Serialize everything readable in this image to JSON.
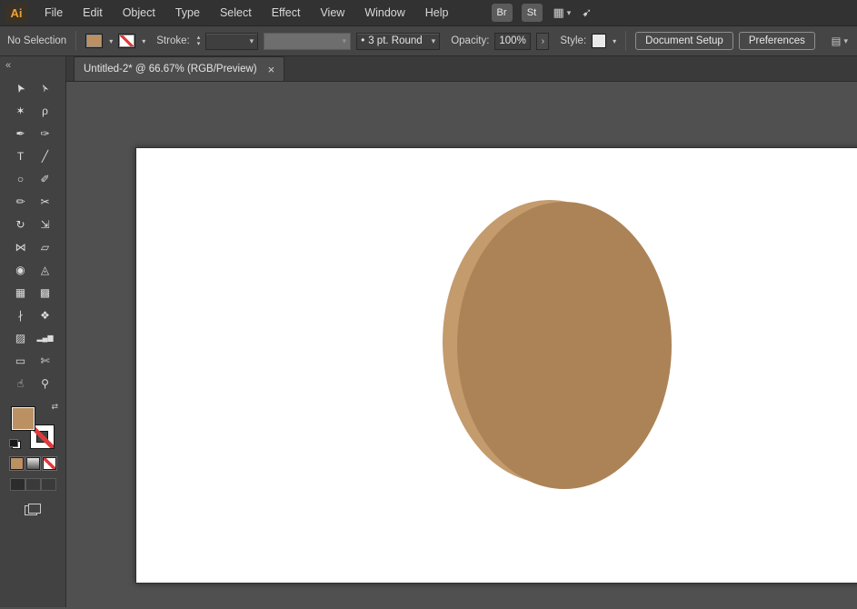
{
  "app": {
    "logo": "Ai"
  },
  "menu": {
    "items": [
      "File",
      "Edit",
      "Object",
      "Type",
      "Select",
      "Effect",
      "View",
      "Window",
      "Help"
    ]
  },
  "topbar": {
    "bridge": "Br",
    "stock": "St"
  },
  "control": {
    "status": "No Selection",
    "stroke_label": "Stroke:",
    "brush_tip": "•",
    "brush_name": "3 pt. Round",
    "opacity_label": "Opacity:",
    "opacity_value": "100%",
    "style_label": "Style:",
    "document_setup": "Document Setup",
    "preferences": "Preferences"
  },
  "tab": {
    "title": "Untitled-2* @ 66.67% (RGB/Preview)",
    "close": "×"
  },
  "icons": {
    "chevron_down": "▾",
    "chevron_right": "›",
    "spinner_up": "▴",
    "spinner_down": "▾",
    "collapse_left": "«",
    "swap": "⇄",
    "arrange_grid": "▦",
    "gpu": "➹",
    "panel": "▤"
  },
  "tools": [
    {
      "name": "selection-tool",
      "glyph": "➤"
    },
    {
      "name": "direct-selection-tool",
      "glyph": "➢"
    },
    {
      "name": "magic-wand-tool",
      "glyph": "✶"
    },
    {
      "name": "lasso-tool",
      "glyph": "ρ"
    },
    {
      "name": "pen-tool",
      "glyph": "✒"
    },
    {
      "name": "curvature-tool",
      "glyph": "✑"
    },
    {
      "name": "type-tool",
      "glyph": "T"
    },
    {
      "name": "line-segment-tool",
      "glyph": "╱"
    },
    {
      "name": "ellipse-tool",
      "glyph": "○"
    },
    {
      "name": "paintbrush-tool",
      "glyph": "✐"
    },
    {
      "name": "pencil-tool",
      "glyph": "✏"
    },
    {
      "name": "scissors-tool",
      "glyph": "✂"
    },
    {
      "name": "rotate-tool",
      "glyph": "↻"
    },
    {
      "name": "scale-tool",
      "glyph": "⇲"
    },
    {
      "name": "width-tool",
      "glyph": "⋈"
    },
    {
      "name": "free-transform-tool",
      "glyph": "▱"
    },
    {
      "name": "shape-builder-tool",
      "glyph": "◉"
    },
    {
      "name": "perspective-grid-tool",
      "glyph": "◬"
    },
    {
      "name": "mesh-tool",
      "glyph": "▦"
    },
    {
      "name": "gradient-tool",
      "glyph": "▩"
    },
    {
      "name": "eyedropper-tool",
      "glyph": "∤"
    },
    {
      "name": "blend-tool",
      "glyph": "❖"
    },
    {
      "name": "symbol-sprayer-tool",
      "glyph": "▨"
    },
    {
      "name": "column-graph-tool",
      "glyph": "▂▄▆"
    },
    {
      "name": "artboard-tool",
      "glyph": "▭"
    },
    {
      "name": "slice-tool",
      "glyph": "✄"
    },
    {
      "name": "hand-tool",
      "glyph": "☝"
    },
    {
      "name": "zoom-tool",
      "glyph": "⚲"
    }
  ],
  "colors": {
    "fill_brown": "#BB9164",
    "ellipse_front": "#AC8356",
    "ellipse_back": "#C49B6D",
    "none_red": "#E03A3A"
  }
}
